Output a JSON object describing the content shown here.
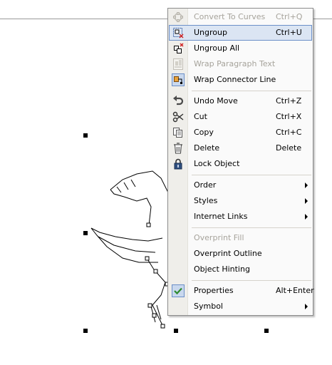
{
  "context_menu": {
    "items": [
      {
        "label": "Convert To Curves",
        "shortcut": "Ctrl+Q",
        "icon": "convert-to-curves-icon",
        "enabled": false
      },
      {
        "label": "Ungroup",
        "shortcut": "Ctrl+U",
        "icon": "ungroup-icon",
        "enabled": true,
        "selected": true
      },
      {
        "label": "Ungroup All",
        "shortcut": "",
        "icon": "ungroup-all-icon",
        "enabled": true
      },
      {
        "label": "Wrap Paragraph Text",
        "shortcut": "",
        "icon": "wrap-paragraph-text-icon",
        "enabled": false
      },
      {
        "label": "Wrap Connector Line",
        "shortcut": "",
        "icon": "wrap-connector-line-icon",
        "enabled": true
      },
      {
        "label": "Undo Move",
        "shortcut": "Ctrl+Z",
        "icon": "undo-icon",
        "enabled": true
      },
      {
        "label": "Cut",
        "shortcut": "Ctrl+X",
        "icon": "scissors-icon",
        "enabled": true
      },
      {
        "label": "Copy",
        "shortcut": "Ctrl+C",
        "icon": "copy-icon",
        "enabled": true
      },
      {
        "label": "Delete",
        "shortcut": "Delete",
        "icon": "trash-icon",
        "enabled": true
      },
      {
        "label": "Lock Object",
        "shortcut": "",
        "icon": "lock-icon",
        "enabled": true
      },
      {
        "label": "Order",
        "shortcut": "",
        "submenu": true,
        "enabled": true
      },
      {
        "label": "Styles",
        "shortcut": "",
        "submenu": true,
        "enabled": true
      },
      {
        "label": "Internet Links",
        "shortcut": "",
        "submenu": true,
        "enabled": true
      },
      {
        "label": "Overprint Fill",
        "shortcut": "",
        "enabled": false
      },
      {
        "label": "Overprint Outline",
        "shortcut": "",
        "enabled": true
      },
      {
        "label": "Object Hinting",
        "shortcut": "",
        "enabled": true
      },
      {
        "label": "Properties",
        "shortcut": "Alt+Enter",
        "icon": "checkmark-icon",
        "enabled": true
      },
      {
        "label": "Symbol",
        "shortcut": "",
        "submenu": true,
        "enabled": true
      }
    ]
  },
  "colors": {
    "selection_fill": "#dbe5f3",
    "selection_border": "#6b8fc8",
    "disabled_text": "#a6a39b",
    "checkmark": "#2e8b2e"
  }
}
